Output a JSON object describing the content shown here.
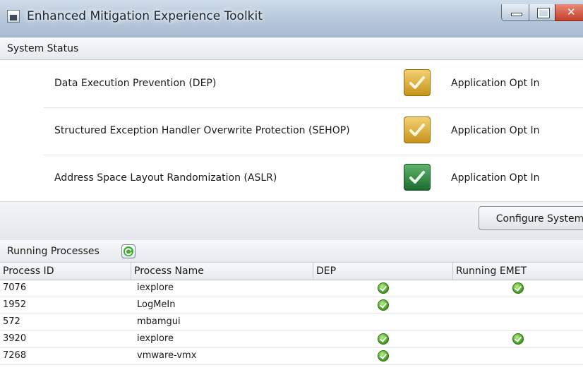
{
  "window": {
    "title": "Enhanced Mitigation Experience Toolkit",
    "icon": "app-window-icon",
    "controls": [
      "minimize-icon",
      "maximize-icon",
      "close-icon"
    ]
  },
  "system_status": {
    "header": "System Status",
    "rows": [
      {
        "label": "Data Execution Prevention (DEP)",
        "value": "Application Opt In",
        "check_color": "#d4a62f"
      },
      {
        "label": "Structured Exception Handler Overwrite Protection (SEHOP)",
        "value": "Application Opt In",
        "check_color": "#d4a62f"
      },
      {
        "label": "Address Space Layout Randomization (ASLR)",
        "value": "Application Opt In",
        "check_color": "#2f8a3f"
      }
    ],
    "configure_button": "Configure System"
  },
  "running_processes": {
    "header": "Running Processes",
    "refresh_icon": "refresh-icon",
    "columns": [
      "Process ID",
      "Process Name",
      "DEP",
      "Running EMET"
    ],
    "rows": [
      {
        "pid": "7076",
        "name": "iexplore",
        "dep": true,
        "emet": true
      },
      {
        "pid": "1952",
        "name": "LogMeIn",
        "dep": true,
        "emet": false
      },
      {
        "pid": "572",
        "name": "mbamgui",
        "dep": false,
        "emet": false
      },
      {
        "pid": "3920",
        "name": "iexplore",
        "dep": true,
        "emet": true
      },
      {
        "pid": "7268",
        "name": "vmware-vmx",
        "dep": true,
        "emet": false
      }
    ]
  }
}
